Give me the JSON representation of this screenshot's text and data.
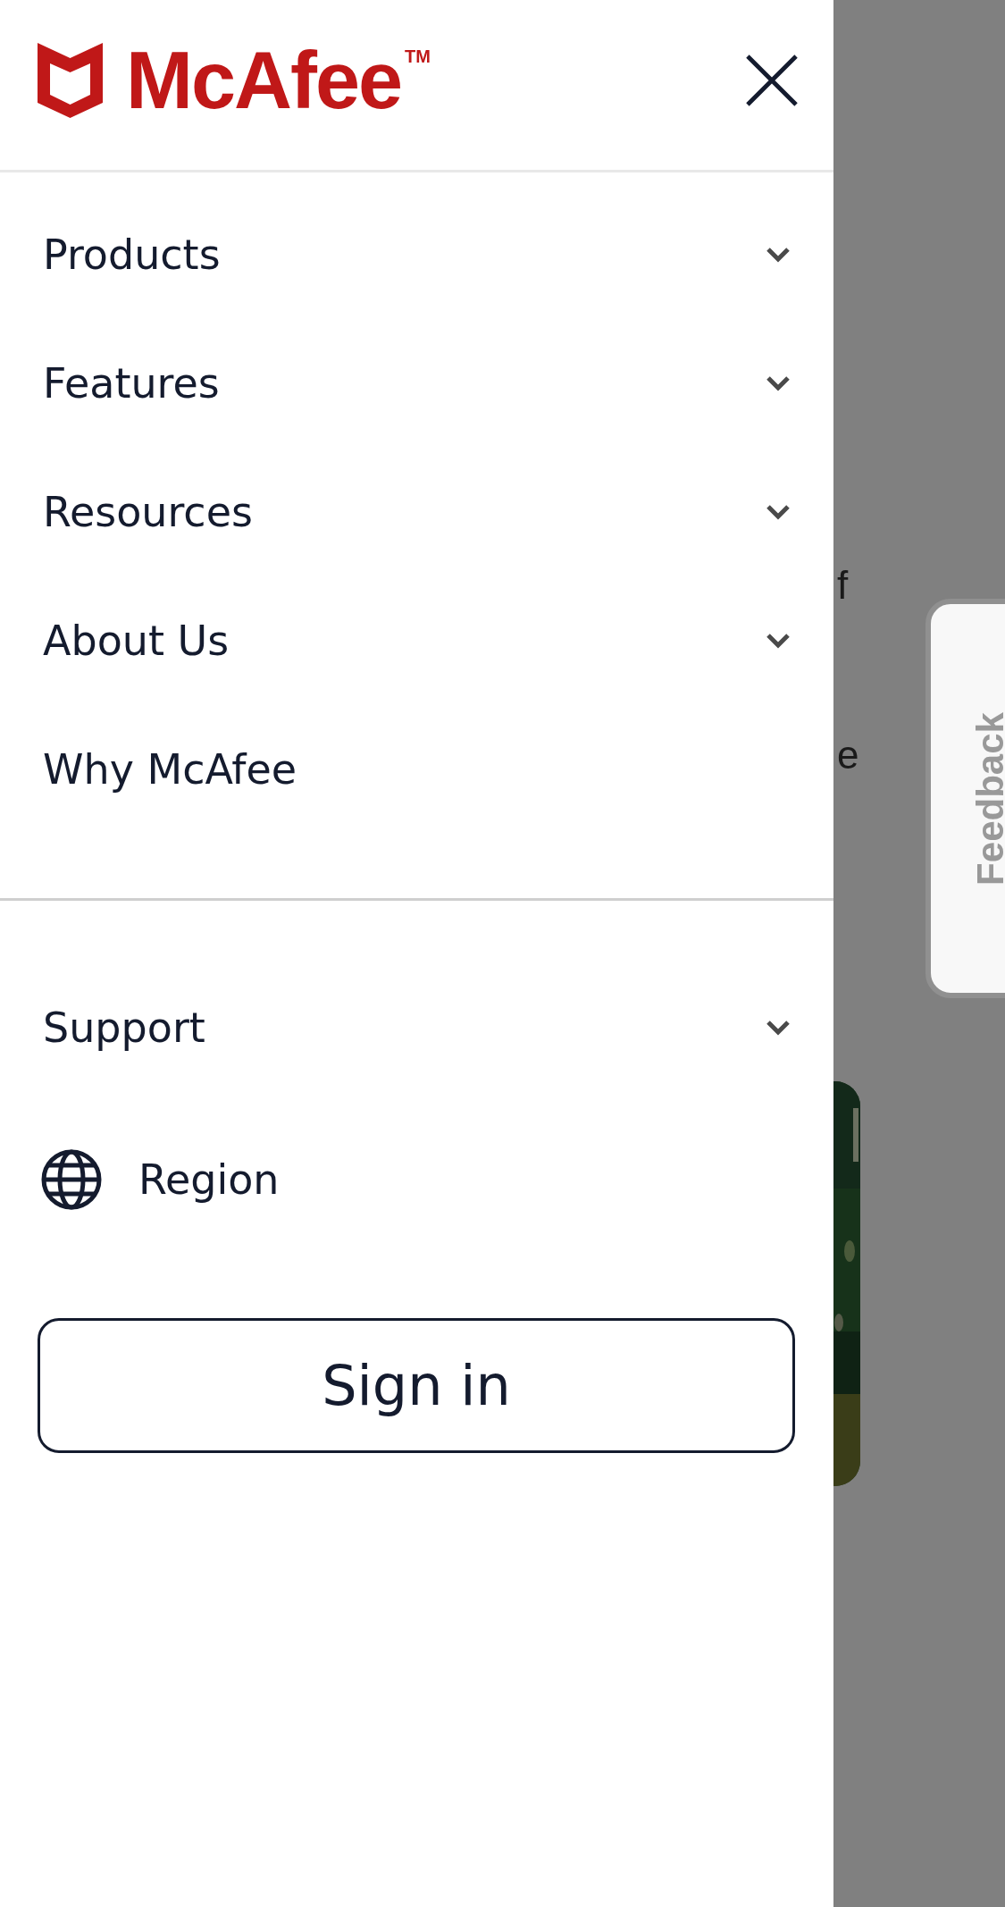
{
  "backdrop": {
    "letters": [
      "f",
      "e"
    ],
    "feedback_tab": {
      "label": "Feedback"
    }
  },
  "menu": {
    "logo": {
      "text": "McAfee",
      "mark": "TM"
    },
    "items": [
      {
        "label": "Products",
        "kind": "dropdown",
        "expanded": false
      },
      {
        "label": "Features",
        "kind": "dropdown",
        "expanded": false
      },
      {
        "label": "Resources",
        "kind": "dropdown",
        "expanded": false
      },
      {
        "label": "About Us",
        "kind": "dropdown",
        "expanded": false
      },
      {
        "label": "Why McAfee",
        "kind": "link"
      }
    ],
    "secondary_items": [
      {
        "label": "Support",
        "kind": "dropdown",
        "expanded": false
      },
      {
        "label": "Region",
        "kind": "region"
      }
    ],
    "sign_in": {
      "label": "Sign in"
    }
  }
}
